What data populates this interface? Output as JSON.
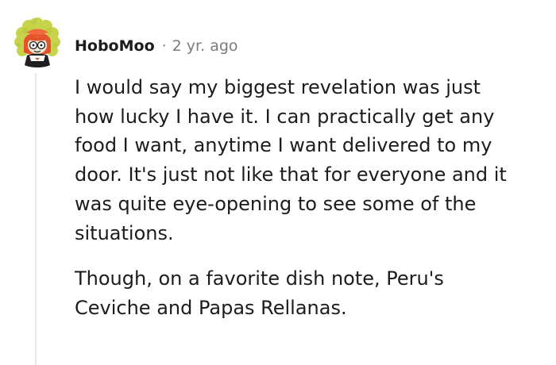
{
  "comment": {
    "author": "HoboMoo",
    "separator": "·",
    "time": "2 yr. ago",
    "paragraphs": [
      [
        "I would say my biggest revelation was just",
        "how lucky I have it. I can practically get any",
        "food I want, anytime I want delivered to my",
        "door. It's just not like that for everyone and it",
        "was quite eye-opening to see some of the",
        "situations."
      ],
      [
        "Though, on a favorite dish note, Peru's",
        "Ceviche and Papas Rellanas."
      ]
    ],
    "avatar_icon": "cartoon-avatar-icon",
    "colors": {
      "text": "#1c1c1c",
      "meta": "#7c7c7c",
      "thread_line": "#e5e7eb",
      "avatar_hair": "#c7d44b",
      "avatar_hood": "#e4542b",
      "avatar_face": "#f6e8d2"
    }
  }
}
